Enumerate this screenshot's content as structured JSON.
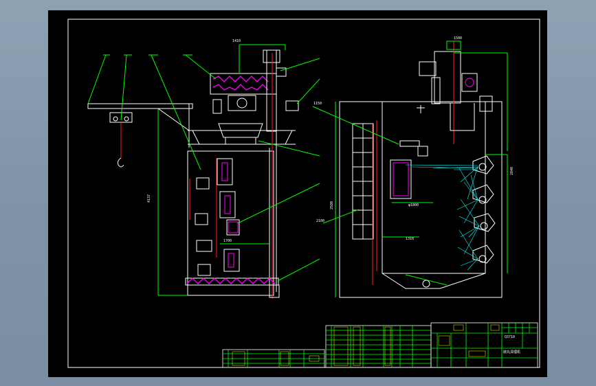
{
  "colors": {
    "viewport_bg": "#8fa1b3",
    "paper": "#000000",
    "frame": "#ffffff",
    "green": "#00ff00",
    "white": "#ffffff",
    "red": "#ff2020",
    "magenta": "#ff00ff",
    "cyan": "#00ffff",
    "yellow": "#ffff00"
  },
  "labels": {
    "dim_top_left": "1410",
    "dim_top_right": "1500",
    "dim_height_left": "4137",
    "dim_height_right": "2580",
    "dim_upper_right": "2840",
    "dim_inner": "φ1800",
    "dim_width": "1700",
    "callout_a": "1310",
    "callout_b": "2100",
    "callout_c": "1150"
  },
  "title_block": {
    "stamp": "Q3710",
    "company": "抛丸清理机"
  }
}
